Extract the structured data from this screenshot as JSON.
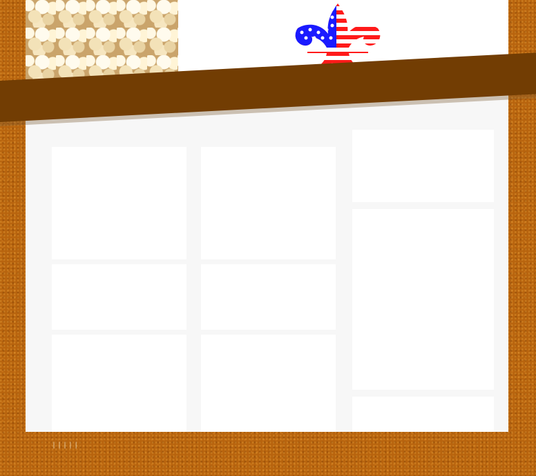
{
  "header": {
    "photo_icon": "popcorn-photo",
    "logo_icon": "fleur-de-lis-flag-icon"
  },
  "colors": {
    "background": "#b8640e",
    "banner": "#723d03",
    "content": "#f7f7f7",
    "panel": "#ffffff",
    "flag_blue": "#1a1aff",
    "flag_red": "#ff1a1a"
  },
  "footer": {
    "marks": "|||||"
  }
}
